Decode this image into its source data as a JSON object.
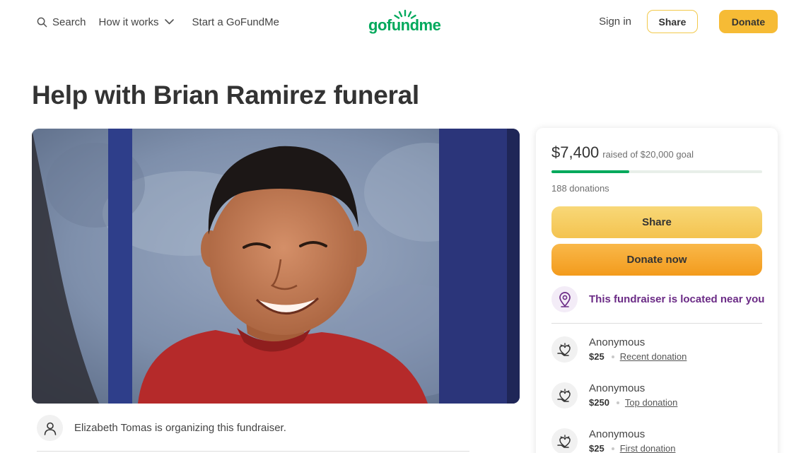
{
  "header": {
    "nav": [
      {
        "label": "Search",
        "icon": "search-icon"
      },
      {
        "label": "How it works",
        "icon": "chevron-down-icon"
      },
      {
        "label": "Start a GoFundMe"
      }
    ],
    "logo_text": "gofundme",
    "sign_in": "Sign in",
    "share_label": "Share",
    "donate_label": "Donate"
  },
  "page": {
    "title": "Help with Brian Ramirez funeral",
    "organizer": "Elizabeth Tomas is organizing this fundraiser."
  },
  "card": {
    "raised_amount": "$7,400",
    "raised_goal": "raised of $20,000 goal",
    "progress_fraction": 0.37,
    "donation_count": "188 donations",
    "share_label": "Share",
    "donate_label": "Donate now",
    "location_text": "This fundraiser is located near you",
    "donations": [
      {
        "name": "Anonymous",
        "amount": "$25",
        "tag": "Recent donation"
      },
      {
        "name": "Anonymous",
        "amount": "$250",
        "tag": "Top donation"
      },
      {
        "name": "Anonymous",
        "amount": "$25",
        "tag": "First donation"
      }
    ]
  },
  "colors": {
    "brand_green": "#02a95c",
    "accent_yellow": "#f6bb35",
    "location_purple": "#6b2b86"
  }
}
